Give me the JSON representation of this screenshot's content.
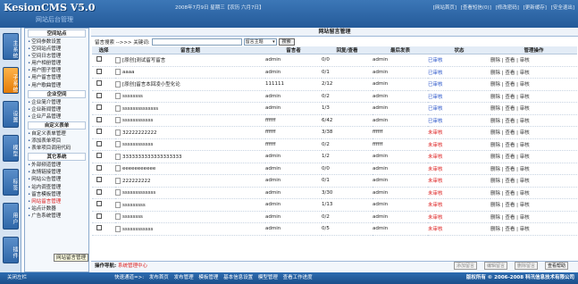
{
  "header": {
    "logo": "KesionCMS V5.0",
    "logo_sub": "网站后台管理",
    "date": "2008年7月9日 星期三【农历 六月7日】",
    "links": [
      "[网站首页]",
      "[查看短信(0)]",
      "[修改密码]",
      "[更新缓存]",
      "[安全退出]"
    ]
  },
  "side_tabs": [
    "主系统",
    "子系统",
    "设置",
    "模型",
    "标签",
    "用户",
    "插件"
  ],
  "sidebar": {
    "sections": [
      {
        "title": "空间站点",
        "items": [
          "空间参数设置",
          "空间站点管理",
          "空间日志管理",
          "用户相册管理",
          "用户圈子管理",
          "用户留言管理",
          "用户歌曲管理"
        ]
      },
      {
        "title": "企业空间",
        "items": [
          "企业简介管理",
          "企业新闻管理",
          "企业产品管理"
        ]
      },
      {
        "title": "自定义表单",
        "items": [
          "自定义表单管理",
          "添加表单项目",
          "表单项目调用代码"
        ]
      },
      {
        "title": "其它系统",
        "items": [
          "外部频道管理",
          "友情链接管理",
          "网站公告管理",
          "站内调查管理",
          "留言模板管理",
          "网站留言管理",
          "站点计数器",
          "广告系统管理"
        ]
      }
    ],
    "active_item": "网站留言管理",
    "tooltip": "网站留言管理"
  },
  "main": {
    "title": "网站留言管理",
    "search_label": "留言搜索 -->>> 关键词:",
    "search_placeholder": "",
    "search_field": "留言主题",
    "search_button": "搜索",
    "columns": [
      "选择",
      "留言主题",
      "留言者",
      "回复/查看",
      "最后发表",
      "状态",
      "管理操作"
    ],
    "rows": [
      {
        "subject": "[原创]测试留写留言",
        "author": "admin",
        "reply": "0/0",
        "last": "admin",
        "status": "已审核",
        "ok": true
      },
      {
        "subject": "aaaa",
        "author": "admin",
        "reply": "0/1",
        "last": "admin",
        "status": "已审核",
        "ok": true
      },
      {
        "subject": "[原创]留言本回凌小型化论",
        "author": "111111",
        "reply": "2/12",
        "last": "admin",
        "status": "已审核",
        "ok": true
      },
      {
        "subject": "ssssssss",
        "author": "admin",
        "reply": "0/2",
        "last": "admin",
        "status": "已审核",
        "ok": true
      },
      {
        "subject": "ssssssssssssss",
        "author": "admin",
        "reply": "1/3",
        "last": "admin",
        "status": "已审核",
        "ok": true
      },
      {
        "subject": "ssssssssssss",
        "author": "ffffff",
        "reply": "6/42",
        "last": "admin",
        "status": "已审核",
        "ok": true
      },
      {
        "subject": "32222222222",
        "author": "ffffff",
        "reply": "3/38",
        "last": "ffffff",
        "status": "未审核",
        "ok": false
      },
      {
        "subject": "ssssssssssss",
        "author": "ffffff",
        "reply": "0/2",
        "last": "ffffff",
        "status": "未审核",
        "ok": false
      },
      {
        "subject": "3333333333333333333",
        "author": "admin",
        "reply": "1/2",
        "last": "admin",
        "status": "未审核",
        "ok": false
      },
      {
        "subject": "eeeeeeeeeee",
        "author": "admin",
        "reply": "0/0",
        "last": "admin",
        "status": "未审核",
        "ok": false
      },
      {
        "subject": "222222222",
        "author": "admin",
        "reply": "0/1",
        "last": "admin",
        "status": "未审核",
        "ok": false
      },
      {
        "subject": "sssssssssssss",
        "author": "admin",
        "reply": "3/30",
        "last": "admin",
        "status": "未审核",
        "ok": false
      },
      {
        "subject": "sssssssss",
        "author": "admin",
        "reply": "1/13",
        "last": "admin",
        "status": "未审核",
        "ok": false
      },
      {
        "subject": "ssssssss",
        "author": "admin",
        "reply": "0/2",
        "last": "admin",
        "status": "未审核",
        "ok": false
      },
      {
        "subject": "ssssssssssss",
        "author": "admin",
        "reply": "0/5",
        "last": "admin",
        "status": "未审核",
        "ok": false
      }
    ],
    "ops": "删除 | 查看 | 审核",
    "nav_label": "操作导航:",
    "nav_link": "系统管理中心",
    "bottom_buttons": [
      "添加留言",
      "编辑留言",
      "删除留言",
      "查看帮助"
    ]
  },
  "footer": {
    "close": "关闭左栏",
    "quick_label": "快速通道=>:",
    "quick": [
      "发布首页",
      "发布管理",
      "模板管理",
      "基本信息设置",
      "模型管理",
      "查看工作进度"
    ],
    "copyright": "版权所有 © 2006-2008 科汛信息技术有限公司"
  }
}
